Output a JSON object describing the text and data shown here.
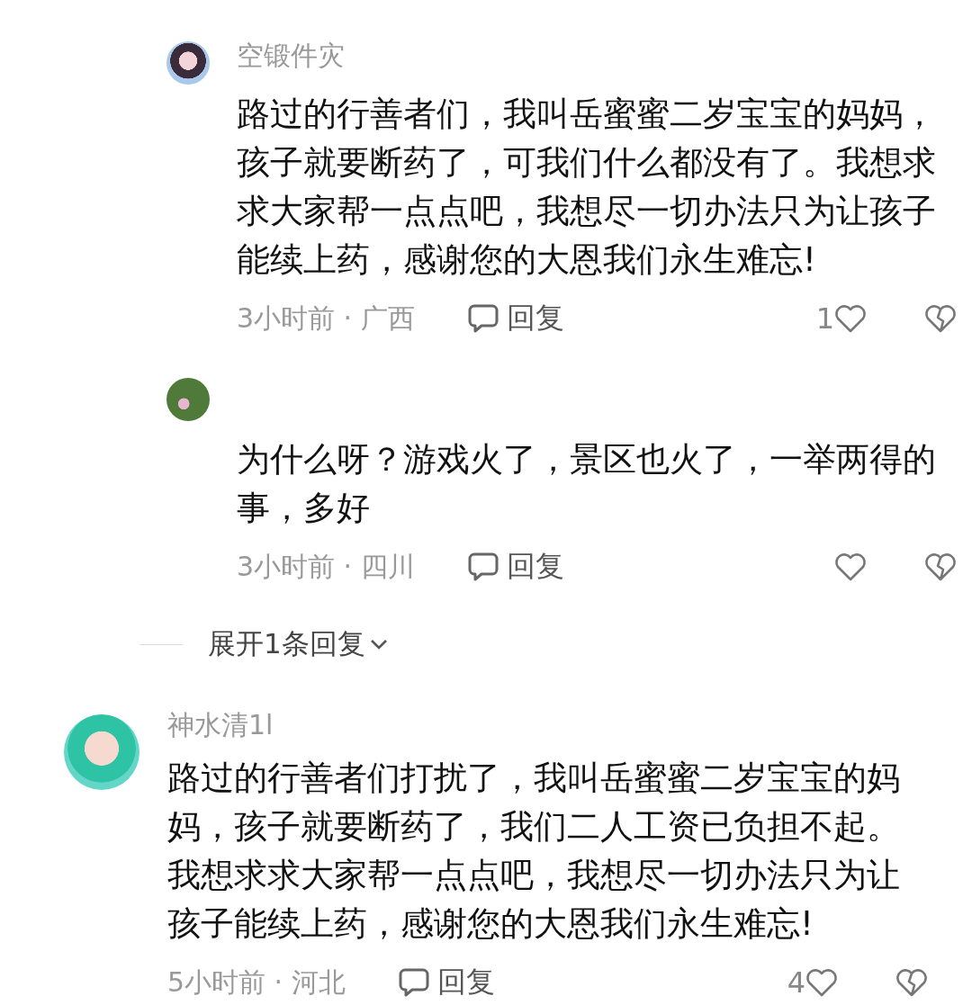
{
  "comments": [
    {
      "kind": "reply",
      "author": "空锻件灾",
      "text": "路过的行善者们，我叫岳蜜蜜二岁宝宝的妈妈，孩子就要断药了，可我们什么都没有了。我想求求大家帮一点点吧，我想尽一切办法只为让孩子能续上药，感谢您的大恩我们永生难忘!",
      "meta": "3小时前 · 广西",
      "reply_label": "回复",
      "likes": "1"
    },
    {
      "kind": "reply",
      "text": "为什么呀？游戏火了，景区也火了，一举两得的事，多好",
      "meta": "3小时前 · 四川",
      "reply_label": "回复"
    },
    {
      "kind": "expand",
      "label": "展开1条回复"
    },
    {
      "kind": "top",
      "author": "神水清1l",
      "text": "路过的行善者们打扰了，我叫岳蜜蜜二岁宝宝的妈妈，孩子就要断药了，我们二人工资已负担不起。我想求求大家帮一点点吧，我想尽一切办法只为让孩子能续上药，感谢您的大恩我们永生难忘!",
      "meta": "5小时前 · 河北",
      "reply_label": "回复",
      "likes": "4"
    }
  ]
}
